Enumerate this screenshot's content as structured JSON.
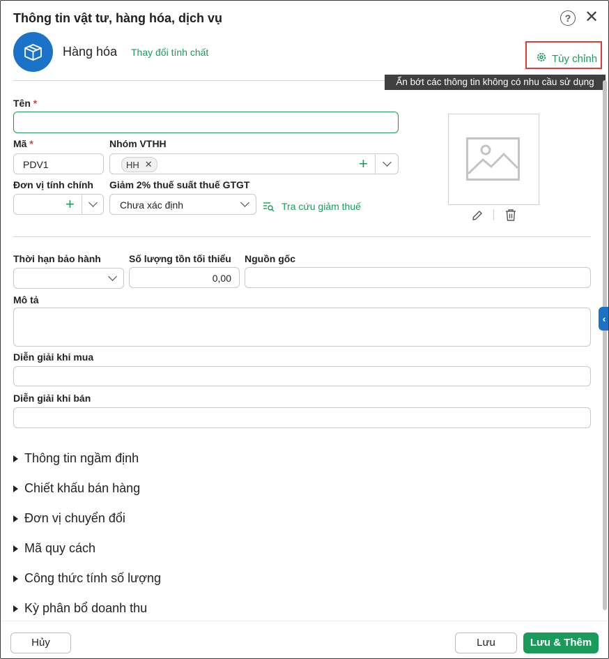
{
  "dialog": {
    "title": "Thông tin vật tư, hàng hóa, dịch vụ",
    "type_label": "Hàng hóa",
    "change_type_link": "Thay đổi tính chất",
    "customize_label": "Tùy chỉnh",
    "tooltip": "Ẩn bớt các thông tin không có nhu cầu sử dụng"
  },
  "form": {
    "name_label": "Tên",
    "required_mark": "*",
    "name_value": "",
    "code_label": "Mã",
    "code_value": "PDV1",
    "group_label": "Nhóm VTHH",
    "group_tag": "HH",
    "unit_label": "Đơn vị tính chính",
    "unit_value": "",
    "tax_label": "Giảm 2% thuế suất thuế GTGT",
    "tax_value": "Chưa xác định",
    "tax_lookup_link": "Tra cứu giảm thuế",
    "warranty_label": "Thời hạn bảo hành",
    "warranty_value": "",
    "min_stock_label": "Số lượng tồn tối thiểu",
    "min_stock_value": "0,00",
    "origin_label": "Nguồn gốc",
    "origin_value": "",
    "description_label": "Mô tả",
    "purchase_desc_label": "Diễn giải khi mua",
    "sale_desc_label": "Diễn giải khi bán"
  },
  "sections": [
    "Thông tin ngầm định",
    "Chiết khấu bán hàng",
    "Đơn vị chuyển đổi",
    "Mã quy cách",
    "Công thức tính số lượng",
    "Kỳ phân bổ doanh thu"
  ],
  "footer": {
    "cancel": "Hủy",
    "save": "Lưu",
    "save_add": "Lưu & Thêm"
  },
  "icons": {
    "help": "help-circle-icon",
    "close": "close-icon",
    "type": "box-icon",
    "customize": "gear-icon",
    "image_placeholder": "image-icon",
    "edit": "pencil-icon",
    "delete": "trash-icon",
    "lookup": "search-list-icon"
  },
  "colors": {
    "accent_green": "#1a9b5c",
    "brand_blue": "#1a73c7",
    "required_red": "#e53935"
  }
}
